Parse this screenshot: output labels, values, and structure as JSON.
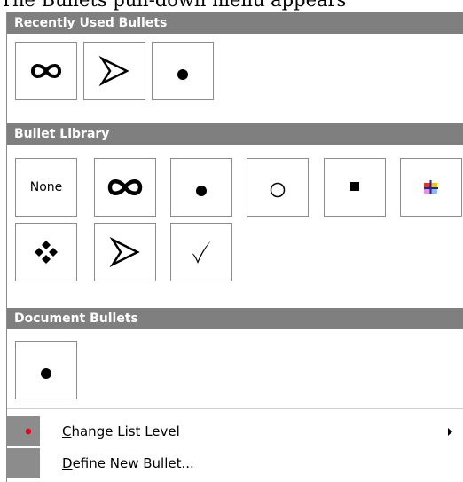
{
  "caption": "The Bullets pull-down menu appears",
  "sections": {
    "recent": {
      "title": "Recently Used Bullets",
      "bullets": [
        {
          "icon": "infinity-icon"
        },
        {
          "icon": "arrowhead-icon"
        },
        {
          "icon": "filled-circle-icon"
        }
      ]
    },
    "library": {
      "title": "Bullet Library",
      "none_label": "None",
      "bullets": [
        {
          "icon": "none-text"
        },
        {
          "icon": "infinity-icon"
        },
        {
          "icon": "filled-circle-icon"
        },
        {
          "icon": "hollow-circle-icon"
        },
        {
          "icon": "filled-square-icon"
        },
        {
          "icon": "colorful-cross-icon"
        },
        {
          "icon": "four-diamonds-icon"
        },
        {
          "icon": "arrowhead-icon"
        },
        {
          "icon": "checkmark-icon"
        }
      ]
    },
    "document": {
      "title": "Document Bullets",
      "bullets": [
        {
          "icon": "filled-circle-icon"
        }
      ]
    }
  },
  "menu_items": {
    "change_list_level": {
      "accel": "C",
      "rest": "hange List Level",
      "has_submenu": true
    },
    "define_new_bullet": {
      "accel": "D",
      "rest": "efine New Bullet..."
    }
  },
  "colors": {
    "header_bg": "#7f7f7f",
    "gutter_bg": "#8c8c8c",
    "indicator": "#e8001c"
  }
}
